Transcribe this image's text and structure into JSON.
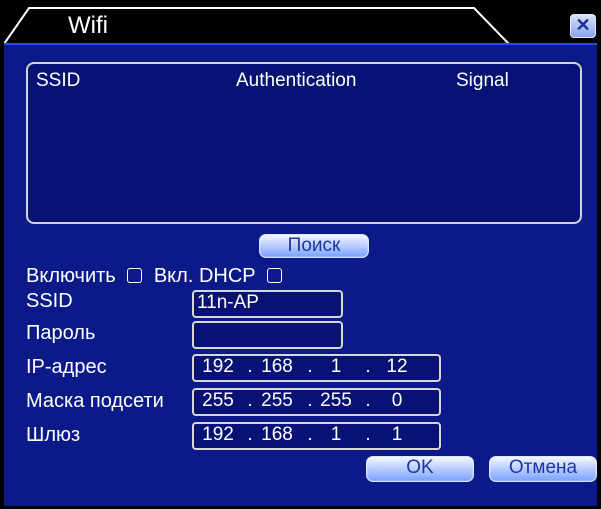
{
  "window": {
    "title": "Wifi"
  },
  "list": {
    "headers": {
      "ssid": "SSID",
      "authentication": "Authentication",
      "signal": "Signal"
    }
  },
  "buttons": {
    "search": "Поиск",
    "ok": "OK",
    "cancel": "Отмена"
  },
  "checkboxes": {
    "enable": "Включить",
    "dhcp": "Вкл. DHCP"
  },
  "fields": {
    "ssid_label": "SSID",
    "ssid_value": "11n-AP",
    "password_label": "Пароль",
    "password_value": "",
    "ip_label": "IP-адрес",
    "ip": [
      "192",
      "168",
      "1",
      "12"
    ],
    "mask_label": "Маска подсети",
    "mask": [
      "255",
      "255",
      "255",
      "0"
    ],
    "gateway_label": "Шлюз",
    "gateway": [
      "192",
      "168",
      "1",
      "1"
    ]
  },
  "colors": {
    "panel": "#0b1a88",
    "list_bg": "#071274",
    "button_text": "#1837a8"
  }
}
